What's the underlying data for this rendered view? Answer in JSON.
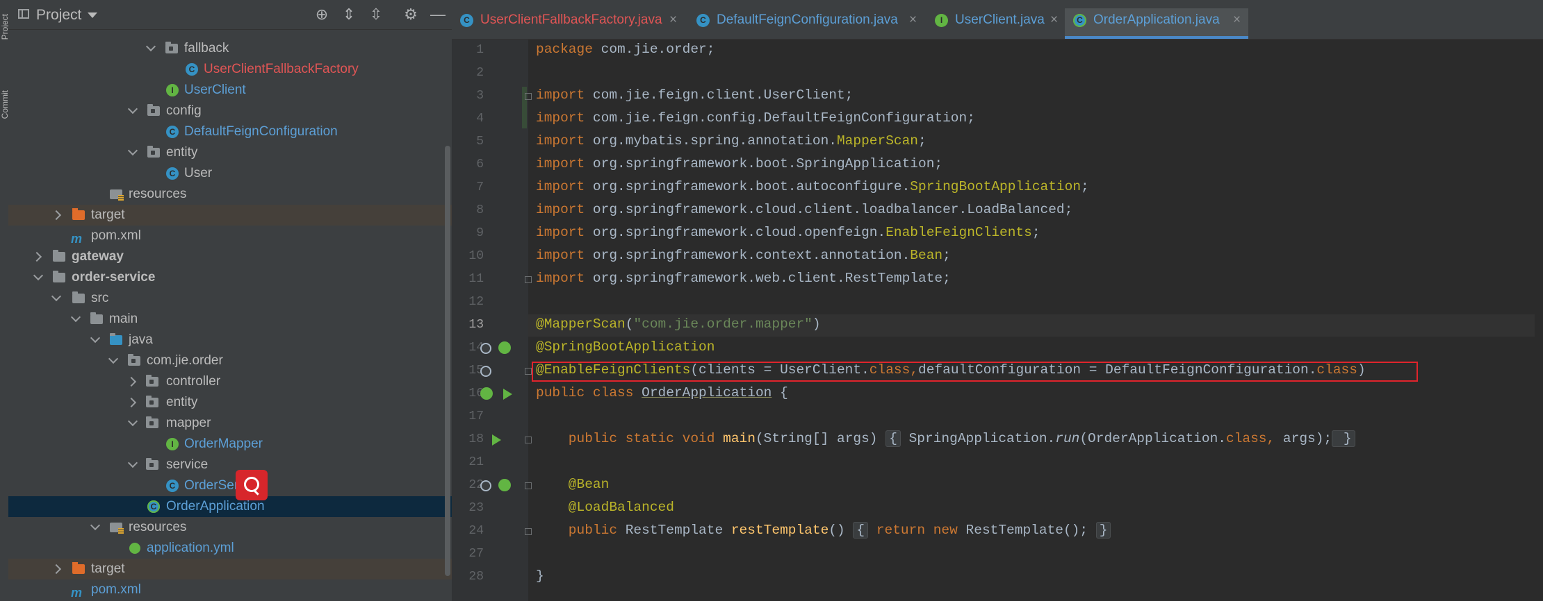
{
  "toolstrip": {
    "project_label": "Project",
    "commit_label": "Commit"
  },
  "project_panel": {
    "title": "Project",
    "tree": [
      {
        "label": "fallback",
        "kind": "package",
        "color": "normal"
      },
      {
        "label": "UserClientFallbackFactory",
        "kind": "class",
        "color": "red"
      },
      {
        "label": "UserClient",
        "kind": "interface",
        "color": "blue"
      },
      {
        "label": "config",
        "kind": "package",
        "color": "normal"
      },
      {
        "label": "DefaultFeignConfiguration",
        "kind": "class",
        "color": "blue"
      },
      {
        "label": "entity",
        "kind": "package",
        "color": "normal"
      },
      {
        "label": "User",
        "kind": "class",
        "color": "normal"
      },
      {
        "label": "resources",
        "kind": "resources",
        "color": "normal"
      },
      {
        "label": "target",
        "kind": "target",
        "color": "normal"
      },
      {
        "label": "pom.xml",
        "kind": "maven",
        "color": "normal"
      },
      {
        "label": "gateway",
        "kind": "module",
        "color": "bold"
      },
      {
        "label": "order-service",
        "kind": "module",
        "color": "bold"
      },
      {
        "label": "src",
        "kind": "folder",
        "color": "normal"
      },
      {
        "label": "main",
        "kind": "folder",
        "color": "normal"
      },
      {
        "label": "java",
        "kind": "source-root",
        "color": "normal"
      },
      {
        "label": "com.jie.order",
        "kind": "package",
        "color": "normal"
      },
      {
        "label": "controller",
        "kind": "package",
        "color": "normal"
      },
      {
        "label": "entity",
        "kind": "package",
        "color": "normal"
      },
      {
        "label": "mapper",
        "kind": "package",
        "color": "normal"
      },
      {
        "label": "OrderMapper",
        "kind": "interface",
        "color": "blue"
      },
      {
        "label": "service",
        "kind": "package",
        "color": "normal"
      },
      {
        "label": "OrderSer",
        "kind": "class",
        "color": "blue"
      },
      {
        "label": "OrderApplication",
        "kind": "spring-app",
        "color": "blue"
      },
      {
        "label": "resources",
        "kind": "resources",
        "color": "normal"
      },
      {
        "label": "application.yml",
        "kind": "yaml",
        "color": "blue"
      },
      {
        "label": "target",
        "kind": "target",
        "color": "normal"
      },
      {
        "label": "pom.xml",
        "kind": "maven",
        "color": "blue"
      }
    ]
  },
  "tabs": [
    {
      "label": "UserClientFallbackFactory.java",
      "icon": "C",
      "color": "red",
      "active": false
    },
    {
      "label": "DefaultFeignConfiguration.java",
      "icon": "C",
      "color": "blue",
      "active": false
    },
    {
      "label": "UserClient.java",
      "icon": "I",
      "color": "blue",
      "active": false
    },
    {
      "label": "OrderApplication.java",
      "icon": "C",
      "color": "blue",
      "active": true
    }
  ],
  "editor": {
    "line_numbers": [
      "1",
      "2",
      "3",
      "4",
      "5",
      "6",
      "7",
      "8",
      "9",
      "10",
      "11",
      "12",
      "13",
      "14",
      "15",
      "16",
      "17",
      "18",
      "21",
      "22",
      "23",
      "24",
      "27",
      "28"
    ],
    "current_line": "13",
    "lines": {
      "l1_kw": "package",
      "l1_rest": " com.jie.order;",
      "import": "import",
      "l3": " com.jie.feign.client.UserClient;",
      "l4": " com.jie.feign.config.DefaultFeignConfiguration;",
      "l5a": " org.mybatis.spring.annotation.",
      "l5b": "MapperScan",
      "l5c": ";",
      "l6": " org.springframework.boot.SpringApplication;",
      "l7a": " org.springframework.boot.autoconfigure.",
      "l7b": "SpringBootApplication",
      "l7c": ";",
      "l8": " org.springframework.cloud.client.loadbalancer.LoadBalanced;",
      "l9a": " org.springframework.cloud.openfeign.",
      "l9b": "EnableFeignClients",
      "l9c": ";",
      "l10a": " org.springframework.context.annotation.",
      "l10b": "Bean",
      "l10c": ";",
      "l11": " org.springframework.web.client.RestTemplate;",
      "l13a": "@MapperScan",
      "l13b": "(",
      "l13c": "\"com.jie.order.mapper\"",
      "l13d": ")",
      "l14": "@SpringBootApplication",
      "l15a": "@EnableFeignClients",
      "l15b": "(clients = UserClient.",
      "l15c": "class",
      "l15d": ",",
      "l15e": "defaultConfiguration = DefaultFeignConfiguration.",
      "l15f": "class",
      "l15g": ")",
      "l16a": "public class",
      "l16b": " ",
      "l16c": "OrderApplication",
      "l16d": " {",
      "l18a": "    public static void",
      "l18b": " ",
      "l18c": "main",
      "l18d": "(String[] args) ",
      "l18e": "{",
      "l18f": " SpringApplication.",
      "l18g": "run",
      "l18h": "(OrderApplication.",
      "l18i": "class",
      "l18j": ", ",
      "l18k": "args);",
      "l18l": " }",
      "l22": "    @Bean",
      "l23": "    @LoadBalanced",
      "l24a": "    public",
      "l24b": " RestTemplate ",
      "l24c": "restTemplate",
      "l24d": "() ",
      "l24e": "{",
      "l24f": " return new",
      "l24g": " RestTemplate(); ",
      "l24h": "}",
      "l28": "}"
    }
  },
  "colors": {
    "keyword": "#cc7832",
    "annotation": "#bbb529",
    "string": "#6a8759",
    "method": "#ffc66d",
    "highlight_box": "#e0242c"
  }
}
